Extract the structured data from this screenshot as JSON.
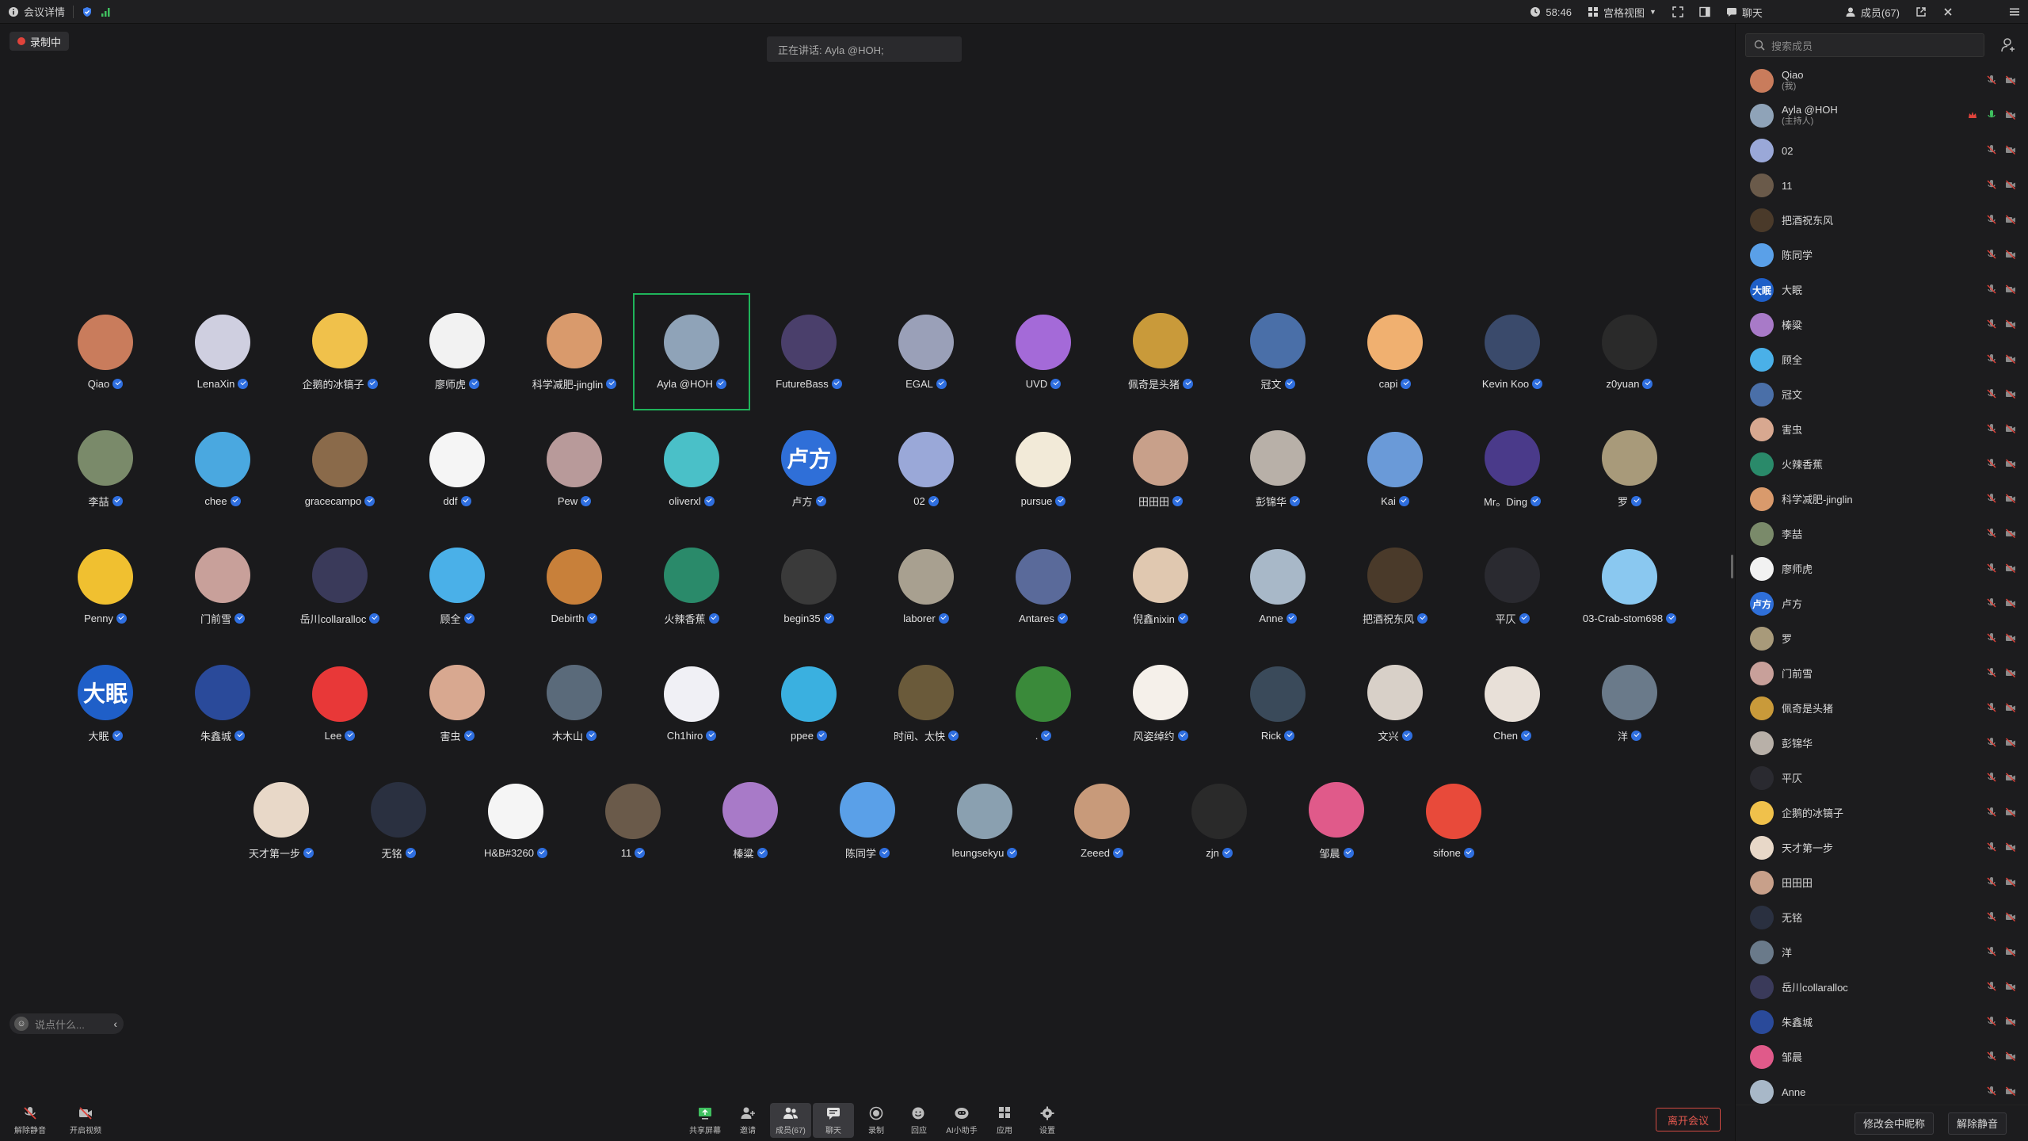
{
  "topbar": {
    "meeting_details": "会议详情",
    "timer": "58:46",
    "view_mode": "宫格视图",
    "chat_tab": "聊天",
    "members_tab": "成员(67)"
  },
  "recording": {
    "label": "录制中"
  },
  "speaking": {
    "label": "正在讲话: Ayla @HOH;"
  },
  "chat_input": {
    "placeholder": "说点什么..."
  },
  "gallery": {
    "rows": [
      [
        {
          "name": "Qiao",
          "color": "#c97c5c"
        },
        {
          "name": "LenaXin",
          "color": "#cfcfe0"
        },
        {
          "name": "企鹅的冰镐子",
          "color": "#f0c14b"
        },
        {
          "name": "廖师虎",
          "color": "#f2f2f2"
        },
        {
          "name": "科学减肥-jinglin",
          "color": "#d99a6c"
        },
        {
          "name": "Ayla @HOH",
          "color": "#8fa3b8",
          "active": true
        },
        {
          "name": "FutureBass",
          "color": "#4a3f6b"
        },
        {
          "name": "EGAL",
          "color": "#9aa0b8"
        },
        {
          "name": "UVD",
          "color": "#a46ad8"
        },
        {
          "name": "佩奇是头猪",
          "color": "#c99a3a"
        },
        {
          "name": "冠文",
          "color": "#4a6fa8"
        },
        {
          "name": "capi",
          "color": "#f0b070"
        },
        {
          "name": "Kevin Koo",
          "color": "#3a4a6b"
        },
        {
          "name": "z0yuan",
          "color": "#2a2a2a"
        }
      ],
      [
        {
          "name": "李喆",
          "color": "#7a8a6a"
        },
        {
          "name": "chee",
          "color": "#4aa8e0"
        },
        {
          "name": "gracecampo",
          "color": "#8a6a4a"
        },
        {
          "name": "ddf",
          "color": "#f5f5f5"
        },
        {
          "name": "Pew",
          "color": "#b89a9a"
        },
        {
          "name": "oliverxl",
          "color": "#4ac0c8"
        },
        {
          "name": "卢方",
          "color": "#2f6fd8",
          "text": "卢方"
        },
        {
          "name": "02",
          "color": "#9aa8d8"
        },
        {
          "name": "pursue",
          "color": "#f2ead8"
        },
        {
          "name": "田田田",
          "color": "#c8a08a"
        },
        {
          "name": "彭锦华",
          "color": "#b8b0a8"
        },
        {
          "name": "Kai",
          "color": "#6a9ad8"
        },
        {
          "name": "Mr。Ding",
          "color": "#4a3a8a"
        },
        {
          "name": "罗",
          "color": "#a89a7a"
        }
      ],
      [
        {
          "name": "Penny",
          "color": "#f0c030"
        },
        {
          "name": "门前雪",
          "color": "#c8a09a"
        },
        {
          "name": "岳川collaralloc",
          "color": "#3a3a5a"
        },
        {
          "name": "顾全",
          "color": "#4ab0e8"
        },
        {
          "name": "Debirth",
          "color": "#c8803a"
        },
        {
          "name": "火辣香蕉",
          "color": "#2a8a6a"
        },
        {
          "name": "begin35",
          "color": "#3a3a3a"
        },
        {
          "name": "laborer",
          "color": "#a8a090"
        },
        {
          "name": "Antares",
          "color": "#5a6a9a"
        },
        {
          "name": "倪鑫nixin",
          "color": "#e0c8b0"
        },
        {
          "name": "Anne",
          "color": "#a8b8c8"
        },
        {
          "name": "把酒祝东风",
          "color": "#4a3a2a"
        },
        {
          "name": "平仄",
          "color": "#2a2a30"
        },
        {
          "name": "03-Crab-stom698",
          "color": "#8ac8f0"
        }
      ],
      [
        {
          "name": "大眠",
          "color": "#1f5fc8",
          "text": "大眠"
        },
        {
          "name": "朱鑫城",
          "color": "#2a4a9a"
        },
        {
          "name": "Lee",
          "color": "#e83838"
        },
        {
          "name": "害虫",
          "color": "#d8a890"
        },
        {
          "name": "木木山",
          "color": "#5a6a7a"
        },
        {
          "name": "Ch1hiro",
          "color": "#f0f0f5"
        },
        {
          "name": "ppee",
          "color": "#3ab0e0"
        },
        {
          "name": "时间、太快",
          "color": "#6a5a3a"
        },
        {
          "name": ".",
          "color": "#3a8a3a"
        },
        {
          "name": "风姿绰约",
          "color": "#f5f0ea"
        },
        {
          "name": "Rick",
          "color": "#3a4a5a"
        },
        {
          "name": "文兴",
          "color": "#d8d0c8"
        },
        {
          "name": "Chen",
          "color": "#e8e0d8"
        },
        {
          "name": "洋",
          "color": "#6a7a8a"
        }
      ],
      [
        {
          "name": "天才第一步",
          "color": "#e8d8c8"
        },
        {
          "name": "无铭",
          "color": "#2a3040"
        },
        {
          "name": "H&B#3260",
          "color": "#f5f5f5"
        },
        {
          "name": "11",
          "color": "#6a5a4a"
        },
        {
          "name": "榛粱",
          "color": "#a87ac8"
        },
        {
          "name": "陈同学",
          "color": "#5aa0e8"
        },
        {
          "name": "leungsekyu",
          "color": "#8aa0b0"
        },
        {
          "name": "Zeeed",
          "color": "#c89a7a"
        },
        {
          "name": "zjn",
          "color": "#2a2a2a"
        },
        {
          "name": "邹晨",
          "color": "#e05a8a"
        },
        {
          "name": "sifone",
          "color": "#e84a3a"
        }
      ]
    ]
  },
  "toolbar": {
    "unmute": "解除静音",
    "start_video": "开启视频",
    "share": "共享屏幕",
    "invite": "邀请",
    "members": "成员(67)",
    "chat": "聊天",
    "record": "录制",
    "reaction": "回应",
    "ai": "AI小助手",
    "apps": "应用",
    "settings": "设置",
    "leave": "离开会议"
  },
  "panel": {
    "search_placeholder": "搜索成员",
    "rename_button": "修改会中昵称",
    "unmute_button": "解除静音",
    "members": [
      {
        "name": "Qiao",
        "sub": "(我)",
        "color": "#c97c5c"
      },
      {
        "name": "Ayla @HOH",
        "sub": "(主持人)",
        "color": "#8fa3b8",
        "host": true
      },
      {
        "name": "02",
        "color": "#9aa8d8"
      },
      {
        "name": "11",
        "color": "#6a5a4a"
      },
      {
        "name": "把酒祝东风",
        "color": "#4a3a2a"
      },
      {
        "name": "陈同学",
        "color": "#5aa0e8"
      },
      {
        "name": "大眠",
        "color": "#1f5fc8",
        "text": "大眠"
      },
      {
        "name": "榛粱",
        "color": "#a87ac8"
      },
      {
        "name": "顾全",
        "color": "#4ab0e8"
      },
      {
        "name": "冠文",
        "color": "#4a6fa8"
      },
      {
        "name": "害虫",
        "color": "#d8a890"
      },
      {
        "name": "火辣香蕉",
        "color": "#2a8a6a"
      },
      {
        "name": "科学减肥-jinglin",
        "color": "#d99a6c"
      },
      {
        "name": "李喆",
        "color": "#7a8a6a"
      },
      {
        "name": "廖师虎",
        "color": "#f2f2f2"
      },
      {
        "name": "卢方",
        "color": "#2f6fd8",
        "text": "卢方"
      },
      {
        "name": "罗",
        "color": "#a89a7a"
      },
      {
        "name": "门前雪",
        "color": "#c8a09a"
      },
      {
        "name": "佩奇是头猪",
        "color": "#c99a3a"
      },
      {
        "name": "彭锦华",
        "color": "#b8b0a8"
      },
      {
        "name": "平仄",
        "color": "#2a2a30"
      },
      {
        "name": "企鹅的冰镐子",
        "color": "#f0c14b"
      },
      {
        "name": "天才第一步",
        "color": "#e8d8c8"
      },
      {
        "name": "田田田",
        "color": "#c8a08a"
      },
      {
        "name": "无铭",
        "color": "#2a3040"
      },
      {
        "name": "洋",
        "color": "#6a7a8a"
      },
      {
        "name": "岳川collaralloc",
        "color": "#3a3a5a"
      },
      {
        "name": "朱鑫城",
        "color": "#2a4a9a"
      },
      {
        "name": "邹晨",
        "color": "#e05a8a"
      },
      {
        "name": "Anne",
        "color": "#a8b8c8"
      }
    ]
  }
}
